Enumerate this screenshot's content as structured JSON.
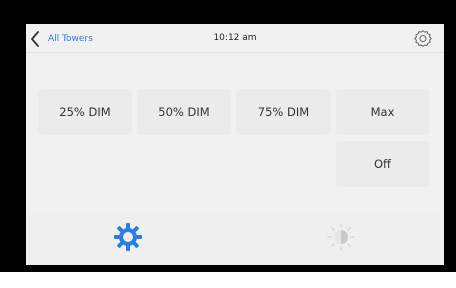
{
  "header": {
    "back_label": "All Towers",
    "time": "10:12 am",
    "back_icon": "chevron-left-icon",
    "settings_icon": "gear-icon"
  },
  "levels": {
    "dim25_label": "25% DIM",
    "dim50_label": "50% DIM",
    "dim75_label": "75% DIM",
    "max_label": "Max",
    "off_label": "Off"
  },
  "footer": {
    "active_tab_icon": "gear-icon",
    "inactive_tab_icon": "brightness-icon"
  },
  "colors": {
    "accent": "#2a7de1",
    "active_icon": "#2a7de1",
    "inactive_icon": "#cfcfcf",
    "screen_bg": "#f1f1f1",
    "button_bg": "#ebebeb"
  }
}
